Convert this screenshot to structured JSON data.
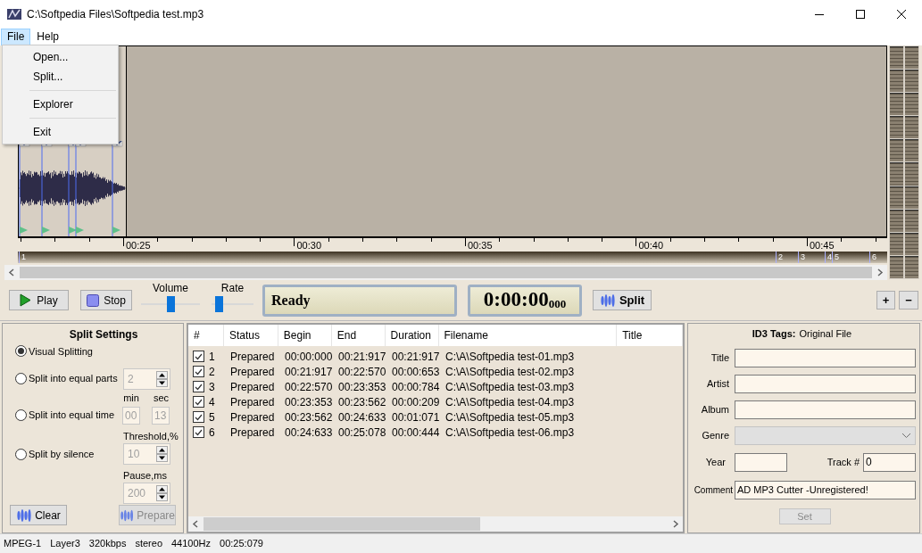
{
  "window": {
    "title": "C:\\Softpedia Files\\Softpedia test.mp3"
  },
  "menu_bar": [
    {
      "label": "File",
      "selected": true
    },
    {
      "label": "Help",
      "selected": false
    }
  ],
  "file_menu": {
    "items": [
      {
        "kind": "item",
        "label": "Open..."
      },
      {
        "kind": "item",
        "label": "Split..."
      },
      {
        "kind": "separator"
      },
      {
        "kind": "item",
        "label": "Explorer"
      },
      {
        "kind": "separator"
      },
      {
        "kind": "item",
        "label": "Exit"
      }
    ]
  },
  "timeline": {
    "ticks": [
      "00:25",
      "00:30",
      "00:35",
      "00:40",
      "00:45"
    ]
  },
  "segment_bar": {
    "labels": [
      "1",
      "2",
      "3",
      "4",
      "5",
      "6"
    ]
  },
  "transport": {
    "play": "Play",
    "stop": "Stop",
    "volume": {
      "label": "Volume",
      "level": 0.5
    },
    "rate": {
      "label": "Rate",
      "level": 0.1
    },
    "status": "Ready",
    "time": "0:00:00",
    "time_ms": "000",
    "split": "Split",
    "zoom_in": "+",
    "zoom_out": "−"
  },
  "split_settings": {
    "title": "Split Settings",
    "inputs_disabled": true,
    "options": [
      {
        "label": "Visual Splitting",
        "selected": true
      },
      {
        "label": "Split into equal parts",
        "selected": false
      },
      {
        "label": "Split into equal time",
        "selected": false
      },
      {
        "label": "Split by silence",
        "selected": false
      }
    ],
    "parts": "2",
    "min_label": "min",
    "sec_label": "sec",
    "min": "00",
    "sec": "13",
    "threshold_label": "Threshold,%",
    "threshold": "10",
    "pause_label": "Pause,ms",
    "pause": "200",
    "clear": "Clear",
    "prepare": {
      "label": "Prepare",
      "disabled": true
    }
  },
  "table": {
    "columns": [
      "#",
      "Status",
      "Begin",
      "End",
      "Duration",
      "Filename",
      "Title"
    ],
    "rows": [
      {
        "checked": true,
        "number": "1",
        "status": "Prepared",
        "begin": "00:00:000",
        "end": "00:21:917",
        "duration": "00:21:917",
        "filename": "C:\\A\\Softpedia test-01.mp3"
      },
      {
        "checked": true,
        "number": "2",
        "status": "Prepared",
        "begin": "00:21:917",
        "end": "00:22:570",
        "duration": "00:00:653",
        "filename": "C:\\A\\Softpedia test-02.mp3"
      },
      {
        "checked": true,
        "number": "3",
        "status": "Prepared",
        "begin": "00:22:570",
        "end": "00:23:353",
        "duration": "00:00:784",
        "filename": "C:\\A\\Softpedia test-03.mp3"
      },
      {
        "checked": true,
        "number": "4",
        "status": "Prepared",
        "begin": "00:23:353",
        "end": "00:23:562",
        "duration": "00:00:209",
        "filename": "C:\\A\\Softpedia test-04.mp3"
      },
      {
        "checked": true,
        "number": "5",
        "status": "Prepared",
        "begin": "00:23:562",
        "end": "00:24:633",
        "duration": "00:01:071",
        "filename": "C:\\A\\Softpedia test-05.mp3"
      },
      {
        "checked": true,
        "number": "6",
        "status": "Prepared",
        "begin": "00:24:633",
        "end": "00:25:078",
        "duration": "00:00:444",
        "filename": "C:\\A\\Softpedia test-06.mp3"
      }
    ]
  },
  "id3": {
    "title": "ID3 Tags:",
    "source": "Original File",
    "fields": [
      {
        "kind": "text",
        "label": "Title"
      },
      {
        "kind": "text",
        "label": "Artist"
      },
      {
        "kind": "text",
        "label": "Album"
      },
      {
        "kind": "dropdown",
        "label": "Genre",
        "disabled": true
      }
    ],
    "year_label": "Year",
    "track_label": "Track #",
    "track": "0",
    "comment_label": "Comment",
    "comment": "AD MP3 Cutter -Unregistered!",
    "set": {
      "label": "Set",
      "disabled": true
    }
  },
  "status_bar": [
    "MPEG-1",
    "Layer3",
    "320kbps",
    "stereo",
    "44100Hz",
    "00:25:079"
  ]
}
